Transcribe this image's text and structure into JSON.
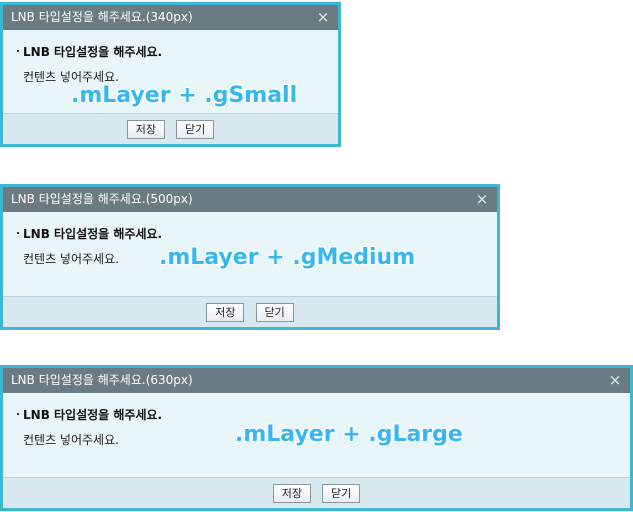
{
  "dialogs": [
    {
      "title": "LNB 타입설정을 해주세요.(340px)",
      "close_icon": "×",
      "heading": "LNB 타입설정을 해주세요.",
      "body_text": "컨텐츠 넣어주세요.",
      "overlay_label": ".mLayer + .gSmall",
      "save_label": "저장",
      "close_label": "닫기"
    },
    {
      "title": "LNB 타입설정을 해주세요.(500px)",
      "close_icon": "×",
      "heading": "LNB 타입설정을 해주세요.",
      "body_text": "컨텐츠 넣어주세요.",
      "overlay_label": ".mLayer + .gMedium",
      "save_label": "저장",
      "close_label": "닫기"
    },
    {
      "title": "LNB 타입설정을 해주세요.(630px)",
      "close_icon": "×",
      "heading": "LNB 타입설정을 해주세요.",
      "body_text": "컨텐츠 넣어주세요.",
      "overlay_label": ".mLayer + .gLarge",
      "save_label": "저장",
      "close_label": "닫기"
    }
  ],
  "colors": {
    "border": "#3cb8d2",
    "titlebar": "#6b7b84",
    "body_bg": "#e8f6fa",
    "footer_bg": "#d7e9ee",
    "overlay_text": "#38b6ee"
  }
}
